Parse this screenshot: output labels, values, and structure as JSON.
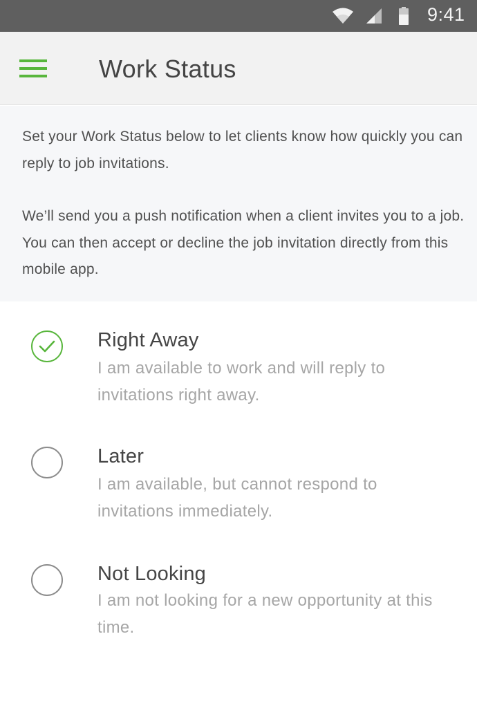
{
  "status_bar": {
    "time": "9:41",
    "icons": [
      "wifi-icon",
      "cell-signal-icon",
      "battery-icon"
    ]
  },
  "app_bar": {
    "menu_icon": "hamburger-menu-icon",
    "title": "Work Status"
  },
  "intro": {
    "paragraph_1": "Set your Work Status below to let clients know how quickly you can reply to job invitations.",
    "paragraph_2": "We’ll send you a push notification when a client invites you to a job. You can then accept or decline the job invitation directly from this mobile app."
  },
  "options": [
    {
      "title": "Right Away",
      "description": "I am available to work and will reply to invitations right away.",
      "selected": true
    },
    {
      "title": "Later",
      "description": "I am available, but cannot respond to invitations immediately.",
      "selected": false
    },
    {
      "title": "Not Looking",
      "description": "I am not looking for a new opportunity at this time.",
      "selected": false
    }
  ],
  "colors": {
    "accent": "#58b63c",
    "status_bar": "#5f5f5f",
    "app_bar": "#f2f2f2",
    "intro_bg": "#f6f7f9",
    "title_text": "#444444",
    "desc_text": "#a6a6a6"
  }
}
